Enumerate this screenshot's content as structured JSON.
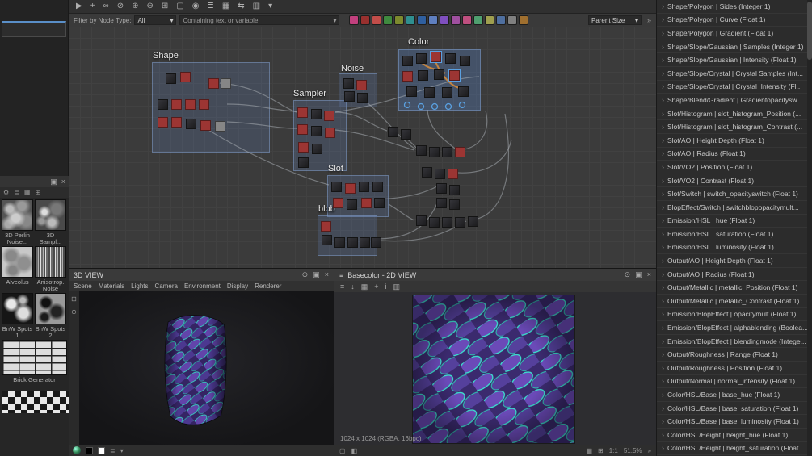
{
  "icons": {
    "chevron_right": "›",
    "close": "×",
    "float": "▣",
    "pin": "⊙",
    "menu": "≡",
    "caret": "▾",
    "overflow": "»",
    "gear": "⚙",
    "grid": "▦",
    "grid2": "⊞",
    "list": "≣",
    "square": "▢",
    "half": "◧",
    "plus": "+",
    "info": "i",
    "hist": "▥",
    "down": "↓",
    "dot": "◉"
  },
  "toolbar": {
    "icons": [
      {
        "glyph": "▶",
        "name": "select-tool-icon"
      },
      {
        "glyph": "+",
        "name": "add-node-icon"
      },
      {
        "glyph": "∞",
        "name": "link-mode-icon"
      },
      {
        "glyph": "⊘",
        "name": "unlink-icon"
      },
      {
        "glyph": "⊕",
        "name": "zoom-in-icon"
      },
      {
        "glyph": "⊖",
        "name": "zoom-out-icon"
      },
      {
        "glyph": "⊞",
        "name": "fit-view-icon"
      },
      {
        "glyph": "▢",
        "name": "frame-selection-icon"
      },
      {
        "glyph": "◉",
        "name": "focus-icon"
      },
      {
        "glyph": "≣",
        "name": "arrange-nodes-icon"
      },
      {
        "glyph": "▦",
        "name": "snap-grid-icon"
      },
      {
        "glyph": "⇆",
        "name": "swap-connections-icon"
      },
      {
        "glyph": "▥",
        "name": "display-options-icon"
      },
      {
        "glyph": "▾",
        "name": "more-tools-icon"
      }
    ]
  },
  "filter_bar": {
    "filter_label": "Filter by Node Type:",
    "filter_value": "All",
    "search_value": "Containing text or variable",
    "parent_size_label": "Parent Size",
    "palette": [
      "#c2407e",
      "#99302e",
      "#c24d49",
      "#3f8a3f",
      "#7d8a2e",
      "#2f8f8f",
      "#2f5f9f",
      "#5f7fbf",
      "#7f4fbf",
      "#9f4f9f",
      "#bf4f7f",
      "#4f9f6f",
      "#9f9f4f",
      "#4f6f9f",
      "#808080",
      "#9f6f2f"
    ]
  },
  "graph": {
    "groups": {
      "shape": "Shape",
      "sampler": "Sampler",
      "noise": "Noise",
      "slot": "Slot",
      "blob": "blob",
      "color": "Color"
    }
  },
  "library": {
    "items": [
      {
        "label": "3D Perlin Noise..."
      },
      {
        "label": "3D Sampl..."
      },
      {
        "label": "Alveolus"
      },
      {
        "label": "Anisotrop. Noise"
      },
      {
        "label": "BnW Spots 1"
      },
      {
        "label": "BnW Spots 2"
      },
      {
        "label": "Brick Generator"
      }
    ]
  },
  "view3d": {
    "title": "3D VIEW",
    "menu": [
      "Scene",
      "Materials",
      "Lights",
      "Camera",
      "Environment",
      "Display",
      "Renderer"
    ]
  },
  "view2d": {
    "title": "Basecolor - 2D VIEW",
    "status": "1024 x 1024 (RGBA, 16bpc)",
    "zoom": "51.5%",
    "actual_size": "1:1"
  },
  "params": {
    "rows": [
      "Shape/Polygon | Sides (Integer 1)",
      "Shape/Polygon | Curve (Float 1)",
      "Shape/Polygon | Gradient (Float 1)",
      "Shape/Slope/Gaussian | Samples (Integer 1)",
      "Shape/Slope/Gaussian | Intensity (Float 1)",
      "Shape/Slope/Crystal | Crystal Samples (Int...",
      "Shape/Slope/Crystal | Crystal_Intensity (Fl...",
      "Shape/Blend/Gradient | Gradientopacitysw...",
      "Slot/Histogram | slot_histogram_Position (...",
      "Slot/Histogram | slot_histogram_Contrast (...",
      "Slot/AO | Height Depth (Float 1)",
      "Slot/AO | Radius (Float 1)",
      "Slot/VO2 | Position (Float 1)",
      "Slot/VO2 | Contrast (Float 1)",
      "Slot/Switch | switch_opacityswitch (Float 1)",
      "BlopEffect/Switch | switchblopopacitymult...",
      "Emission/HSL | hue (Float 1)",
      "Emission/HSL | saturation (Float 1)",
      "Emission/HSL | luminosity (Float 1)",
      "Output/AO | Height Depth (Float 1)",
      "Output/AO | Radius (Float 1)",
      "Output/Metallic | metallic_Position (Float 1)",
      "Output/Metallic | metallic_Contrast (Float 1)",
      "Emission/BlopEffect | opacitymult (Float 1)",
      "Emission/BlopEffect | alphablending (Boolea...",
      "Emission/BlopEffect | blendingmode (Intege...",
      "Output/Roughness | Range (Float 1)",
      "Output/Roughness | Position (Float 1)",
      "Output/Normal | normal_intensity (Float 1)",
      "Color/HSL/Base | base_hue (Float 1)",
      "Color/HSL/Base | base_saturation (Float 1)",
      "Color/HSL/Base | base_luminosity (Float 1)",
      "Color/HSL/Height | height_hue (Float 1)",
      "Color/HSL/Height | height_saturation (Float..."
    ]
  }
}
